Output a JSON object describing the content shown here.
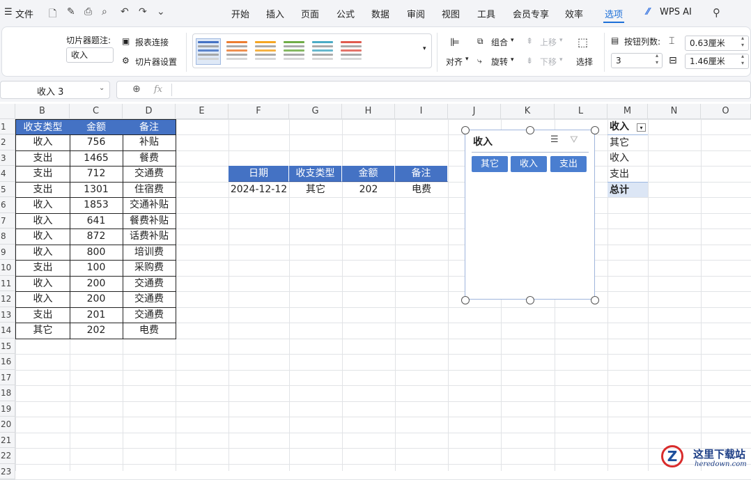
{
  "menubar": {
    "file_label": "文件",
    "tabs": [
      "开始",
      "插入",
      "页面",
      "公式",
      "数据",
      "审阅",
      "视图",
      "工具",
      "会员专享",
      "效率",
      "选项"
    ],
    "active_tab": "选项",
    "wps_ai_label": "WPS AI"
  },
  "ribbon": {
    "slicer_caption_label": "切片器题注:",
    "slicer_caption_value": "收入",
    "report_connections_label": "报表连接",
    "slicer_settings_label": "切片器设置",
    "style_colors": [
      "#4472c4",
      "#ed7d31",
      "#f5a623",
      "#70ad47",
      "#4bacc6",
      "#e05b4f"
    ],
    "align_label": "对齐",
    "group_label": "组合",
    "rotate_label": "旋转",
    "bring_forward_label": "上移",
    "send_backward_label": "下移",
    "select_label": "选择",
    "button_columns_label": "按钮列数:",
    "button_columns_value": "3",
    "button_width_value": "0.63厘米",
    "button_height_value": "1.46厘米"
  },
  "formula_bar": {
    "name_box": "收入 3",
    "fx_label": "fx",
    "formula": ""
  },
  "sheet": {
    "columns": [
      "B",
      "C",
      "D",
      "E",
      "F",
      "G",
      "H",
      "I",
      "J",
      "K",
      "L",
      "M",
      "N",
      "O"
    ],
    "rows": [
      "1",
      "2",
      "3",
      "4",
      "5",
      "6",
      "7",
      "8",
      "9",
      "10",
      "11",
      "12",
      "13",
      "14",
      "15",
      "16",
      "17",
      "18",
      "19",
      "20",
      "21",
      "22",
      "23"
    ],
    "source_table": {
      "headers": [
        "收支类型",
        "金额",
        "备注"
      ],
      "rows": [
        [
          "收入",
          "756",
          "补贴"
        ],
        [
          "支出",
          "1465",
          "餐费"
        ],
        [
          "支出",
          "712",
          "交通费"
        ],
        [
          "支出",
          "1301",
          "住宿费"
        ],
        [
          "收入",
          "1853",
          "交通补贴"
        ],
        [
          "收入",
          "641",
          "餐费补贴"
        ],
        [
          "收入",
          "872",
          "话费补贴"
        ],
        [
          "收入",
          "800",
          "培训费"
        ],
        [
          "支出",
          "100",
          "采购费"
        ],
        [
          "收入",
          "200",
          "交通费"
        ],
        [
          "收入",
          "200",
          "交通费"
        ],
        [
          "支出",
          "201",
          "交通费"
        ],
        [
          "其它",
          "202",
          "电费"
        ]
      ]
    },
    "filtered_table": {
      "headers": [
        "日期",
        "收支类型",
        "金额",
        "备注"
      ],
      "rows": [
        [
          "2024-12-12",
          "其它",
          "202",
          "电费"
        ]
      ]
    },
    "pivot_list": {
      "header": "收入",
      "items": [
        "其它",
        "收入",
        "支出"
      ],
      "total": "总计"
    }
  },
  "slicer": {
    "title": "收入",
    "buttons": [
      "其它",
      "收入",
      "支出"
    ]
  },
  "watermark": {
    "text": "这里下载站",
    "url": "heredown.com"
  }
}
